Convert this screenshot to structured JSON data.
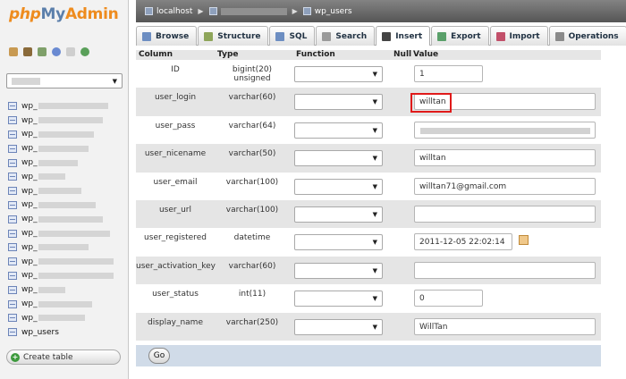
{
  "logo": {
    "part1": "php",
    "part2": "My",
    "part3": "Admin"
  },
  "left_panel": {
    "quick_icons": [
      "home-icon",
      "database-icon",
      "sql-icon",
      "help-icon",
      "docs-icon",
      "reload-icon"
    ],
    "db_select_value": "",
    "tables": [
      {
        "label": "wp_"
      },
      {
        "label": "wp_"
      },
      {
        "label": "wp_"
      },
      {
        "label": "wp_"
      },
      {
        "label": "wp_"
      },
      {
        "label": "wp_"
      },
      {
        "label": "wp_"
      },
      {
        "label": "wp_"
      },
      {
        "label": "wp_"
      },
      {
        "label": "wp_"
      },
      {
        "label": "wp_"
      },
      {
        "label": "wp_"
      },
      {
        "label": "wp_"
      },
      {
        "label": "wp_"
      },
      {
        "label": "wp_"
      },
      {
        "label": "wp_"
      },
      {
        "label": "wp_users"
      }
    ],
    "create_table_label": "Create table"
  },
  "breadcrumb": {
    "server": "localhost",
    "database": "",
    "table": "wp_users"
  },
  "tabs": [
    {
      "label": "Browse",
      "icon": "browse-icon",
      "color": "#6d8ec2"
    },
    {
      "label": "Structure",
      "icon": "structure-icon",
      "color": "#8ea55a"
    },
    {
      "label": "SQL",
      "icon": "sql-icon",
      "color": "#6d8ec2"
    },
    {
      "label": "Search",
      "icon": "search-icon",
      "color": "#9a9a9a"
    },
    {
      "label": "Insert",
      "icon": "insert-icon",
      "color": "#444444"
    },
    {
      "label": "Export",
      "icon": "export-icon",
      "color": "#5aa06a"
    },
    {
      "label": "Import",
      "icon": "import-icon",
      "color": "#c2506a"
    },
    {
      "label": "Operations",
      "icon": "operations-icon",
      "color": "#8a8a8a"
    }
  ],
  "grid": {
    "headers": [
      "Column",
      "Type",
      "Function",
      "Null",
      "Value"
    ],
    "rows": [
      {
        "column": "ID",
        "type": "bigint(20) unsigned",
        "value": "1"
      },
      {
        "column": "user_login",
        "type": "varchar(60)",
        "value": "willtan"
      },
      {
        "column": "user_pass",
        "type": "varchar(64)",
        "value": ""
      },
      {
        "column": "user_nicename",
        "type": "varchar(50)",
        "value": "willtan"
      },
      {
        "column": "user_email",
        "type": "varchar(100)",
        "value": "willtan71@gmail.com"
      },
      {
        "column": "user_url",
        "type": "varchar(100)",
        "value": ""
      },
      {
        "column": "user_registered",
        "type": "datetime",
        "value": "2011-12-05 22:02:14"
      },
      {
        "column": "user_activation_key",
        "type": "varchar(60)",
        "value": ""
      },
      {
        "column": "user_status",
        "type": "int(11)",
        "value": "0"
      },
      {
        "column": "display_name",
        "type": "varchar(250)",
        "value": "WillTan"
      }
    ]
  },
  "go_label": "Go",
  "colors": {
    "highlight": "#e01a1a",
    "breadcrumb_bg": "#666666",
    "go_row_bg": "#d0dbe8"
  }
}
